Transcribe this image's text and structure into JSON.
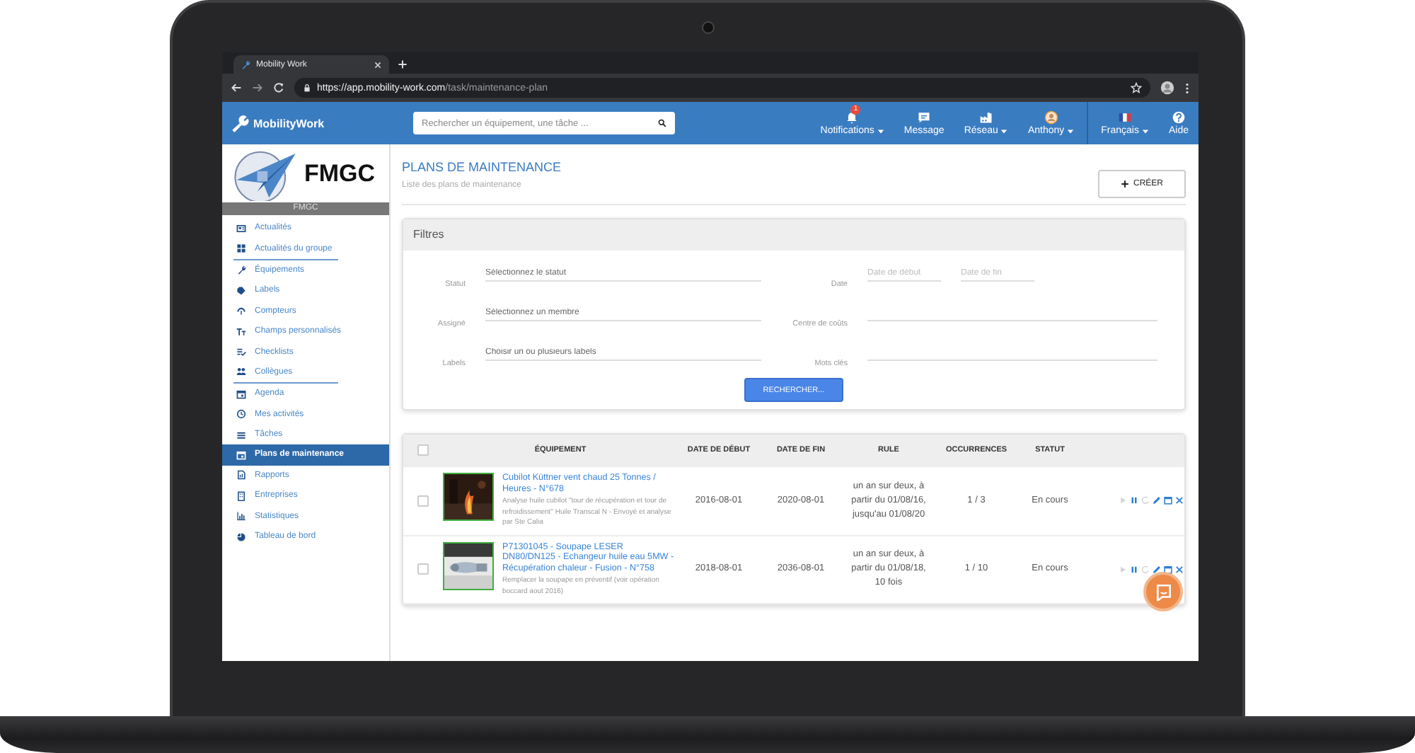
{
  "browser": {
    "tab_title": "Mobility Work",
    "url_host": "https://app.mobility-work.com",
    "url_path": "/task/maintenance-plan"
  },
  "navbar": {
    "brand": "MobilityWork",
    "search_placeholder": "Rechercher un équipement, une tâche ...",
    "items": [
      {
        "kind": "bell",
        "label": "Notifications",
        "badge": "1",
        "caret": true
      },
      {
        "kind": "chat",
        "label": "Message",
        "caret": false
      },
      {
        "kind": "factory",
        "label": "Réseau",
        "caret": true
      },
      {
        "kind": "avatar",
        "label": "Anthony",
        "caret": true
      },
      {
        "kind": "flag",
        "label": "Français",
        "caret": true
      },
      {
        "kind": "help",
        "label": "Aide",
        "caret": false
      }
    ]
  },
  "sidebar": {
    "logo": "FMGC",
    "group": "FMGC",
    "items": [
      {
        "kind": "news",
        "label": "Actualités",
        "selected": false,
        "divider_after": false
      },
      {
        "kind": "grid",
        "label": "Actualités du groupe",
        "selected": false,
        "divider_after": true
      },
      {
        "kind": "wrench",
        "label": "Équipements",
        "selected": false,
        "divider_after": false
      },
      {
        "kind": "tag",
        "label": "Labels",
        "selected": false,
        "divider_after": false
      },
      {
        "kind": "gauge",
        "label": "Compteurs",
        "selected": false,
        "divider_after": false
      },
      {
        "kind": "text",
        "label": "Champs personnalisés",
        "selected": false,
        "divider_after": false
      },
      {
        "kind": "checklist",
        "label": "Checklists",
        "selected": false,
        "divider_after": false
      },
      {
        "kind": "people",
        "label": "Collègues",
        "selected": false,
        "divider_after": true
      },
      {
        "kind": "calendar",
        "label": "Agenda",
        "selected": false,
        "divider_after": false
      },
      {
        "kind": "clock",
        "label": "Mes activités",
        "selected": false,
        "divider_after": false
      },
      {
        "kind": "list",
        "label": "Tâches",
        "selected": false,
        "divider_after": false
      },
      {
        "kind": "calendar",
        "label": "Plans de maintenance",
        "selected": true,
        "divider_after": false
      },
      {
        "kind": "report",
        "label": "Rapports",
        "selected": false,
        "divider_after": false
      },
      {
        "kind": "building",
        "label": "Entreprises",
        "selected": false,
        "divider_after": false
      },
      {
        "kind": "chart",
        "label": "Statistiques",
        "selected": false,
        "divider_after": false
      },
      {
        "kind": "dashboard",
        "label": "Tableau de bord",
        "selected": false,
        "divider_after": false
      }
    ]
  },
  "page": {
    "title": "PLANS DE MAINTENANCE",
    "subtitle": "Liste des plans de maintenance",
    "create_button": "CRÉER"
  },
  "filters": {
    "title": "Filtres",
    "left": [
      {
        "kind": "select",
        "label": "Statut",
        "placeholder": "Sélectionnez le statut"
      },
      {
        "kind": "select",
        "label": "Assigné",
        "placeholder": "Sélectionnez un membre"
      },
      {
        "kind": "select",
        "label": "Labels",
        "placeholder": "Choisir un ou plusieurs labels"
      }
    ],
    "right": [
      {
        "kind": "dates",
        "label": "Date",
        "placeholders": [
          "Date de début",
          "Date de fin"
        ]
      },
      {
        "kind": "text",
        "label": "Centre de coûts"
      },
      {
        "kind": "text",
        "label": "Mots clés"
      }
    ],
    "search_button": "RECHERCHER..."
  },
  "table": {
    "select_all_checked": false,
    "columns": [
      "ÉQUIPEMENT",
      "DATE DE DÉBUT",
      "DATE DE FIN",
      "RULE",
      "OCCURRENCES",
      "STATUT"
    ],
    "rows": [
      {
        "checked": false,
        "title": "Cubilot Küttner vent chaud 25 Tonnes / Heures - N°678",
        "description": "Analyse huile cubilot \"tour de récupération et tour de refroidissement\" Huile Transcal N - Envoyé et analyse par Ste Calia",
        "start": "2016-08-01",
        "end": "2020-08-01",
        "rule": "un an sur deux, à partir du 01/08/16, jusqu'au 01/08/20",
        "occurrences": "1 / 3",
        "status": "En cours"
      },
      {
        "checked": false,
        "title": "P71301045 - Soupape LESER DN80/DN125 - Echangeur huile eau 5MW - Récupération chaleur - Fusion - N°758",
        "description": "Remplacer la soupape en préventif (voir opération boccard aout 2016)",
        "start": "2018-08-01",
        "end": "2036-08-01",
        "rule": "un an sur deux, à partir du 01/08/18, 10 fois",
        "occurrences": "1 / 10",
        "status": "En cours"
      }
    ]
  }
}
